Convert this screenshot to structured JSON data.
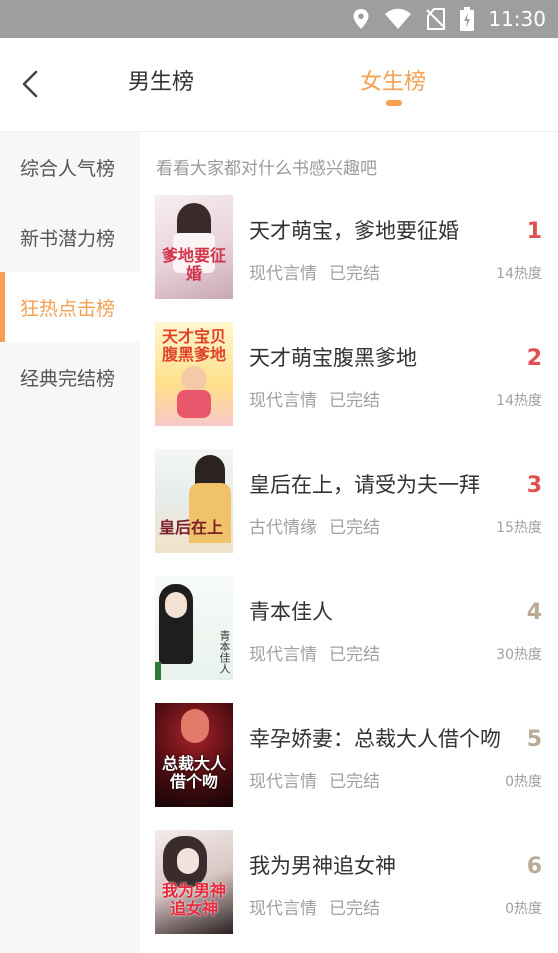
{
  "status_bar": {
    "time": "11:30",
    "icons": [
      "location-icon",
      "wifi-icon",
      "no-sim-icon",
      "battery-icon"
    ]
  },
  "header": {
    "back_icon": "chevron-left-icon",
    "tabs": [
      {
        "label": "男生榜",
        "active": false
      },
      {
        "label": "女生榜",
        "active": true
      }
    ]
  },
  "sidebar": {
    "items": [
      {
        "label": "综合人气榜",
        "active": false
      },
      {
        "label": "新书潜力榜",
        "active": false
      },
      {
        "label": "狂热点击榜",
        "active": true
      },
      {
        "label": "经典完结榜",
        "active": false
      }
    ]
  },
  "main": {
    "subtitle": "看看大家都对什么书感兴趣吧",
    "books": [
      {
        "title": "天才萌宝，爹地要征婚",
        "genre": "现代言情",
        "status": "已完结",
        "rank": "1",
        "heat": "14热度",
        "cover_text": "爹地要征婚"
      },
      {
        "title": "天才萌宝腹黑爹地",
        "genre": "现代言情",
        "status": "已完结",
        "rank": "2",
        "heat": "14热度",
        "cover_text": "天才宝贝腹黑爹地"
      },
      {
        "title": "皇后在上，请受为夫一拜",
        "genre": "古代情缘",
        "status": "已完结",
        "rank": "3",
        "heat": "15热度",
        "cover_text": "皇后在上"
      },
      {
        "title": "青本佳人",
        "genre": "现代言情",
        "status": "已完结",
        "rank": "4",
        "heat": "30热度",
        "cover_text": "青本佳人"
      },
      {
        "title": "幸孕娇妻：总裁大人借个吻",
        "genre": "现代言情",
        "status": "已完结",
        "rank": "5",
        "heat": "0热度",
        "cover_text": "总裁大人借个吻"
      },
      {
        "title": "我为男神追女神",
        "genre": "现代言情",
        "status": "已完结",
        "rank": "6",
        "heat": "0热度",
        "cover_text": "我为男神追女神"
      }
    ]
  },
  "colors": {
    "accent": "#f5a050",
    "rank_top": "#e05050",
    "rank_other": "#b9ab98",
    "status_bar": "#9e9e9e"
  }
}
